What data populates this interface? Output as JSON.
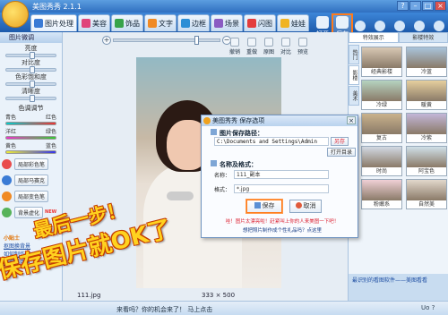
{
  "window": {
    "title": "美图秀秀 2.1.1",
    "logo_text": "Merry Christmas"
  },
  "tabs": [
    {
      "label": "图片处理",
      "icon": "picture-icon",
      "color": "#3a7bd5"
    },
    {
      "label": "美容",
      "icon": "heart-icon",
      "color": "#e0457b"
    },
    {
      "label": "饰品",
      "icon": "flower-icon",
      "color": "#37a34a"
    },
    {
      "label": "文字",
      "icon": "text-icon",
      "color": "#f08a24"
    },
    {
      "label": "边框",
      "icon": "frame-icon",
      "color": "#2c8fd6"
    },
    {
      "label": "场景",
      "icon": "scene-icon",
      "color": "#8b5cc2"
    },
    {
      "label": "闪图",
      "icon": "flash-icon",
      "color": "#e33c3c"
    },
    {
      "label": "娃娃",
      "icon": "doll-icon",
      "color": "#f0b424"
    }
  ],
  "toolbar": {
    "open_label": "打开",
    "save_label": "保存",
    "right_tools": [
      "抠图",
      "旋转",
      "裁剪",
      "尺寸",
      "涂鸦"
    ]
  },
  "left_panel": {
    "header": "图片微调",
    "sliders": [
      "亮度",
      "对比度",
      "色彩饱和度",
      "清晰度"
    ],
    "color_adjust_label": "色调调节",
    "color_pairs": [
      {
        "left": "青色",
        "right": "红色",
        "gradient": "linear-gradient(90deg,#0cc,#e33)"
      },
      {
        "left": "洋红",
        "right": "绿色",
        "gradient": "linear-gradient(90deg,#e3c,#3c3)"
      },
      {
        "left": "黄色",
        "right": "蓝色",
        "gradient": "linear-gradient(90deg,#ee3,#33e)"
      }
    ],
    "buttons": [
      {
        "label": "局部彩色笔",
        "color": "#e94c4c"
      },
      {
        "label": "局部马赛克",
        "color": "#3a7bd5"
      },
      {
        "label": "局部变色笔",
        "color": "#f08a24"
      },
      {
        "label": "背景虚化",
        "color": "#57b35a",
        "new": "NEW"
      }
    ],
    "tips_header": "小贴士",
    "links": [
      "抠图换背景",
      "如何制作闪",
      "局部彩色笔"
    ]
  },
  "canvas": {
    "tools": [
      "撤销",
      "重做",
      "原图",
      "对比",
      "预览"
    ],
    "file_name": "111.jpg",
    "image_size": "333 × 500"
  },
  "right_panel": {
    "tabs": [
      "特效展示",
      "影楼特效"
    ],
    "vertical_tabs": [
      "热门",
      "影楼",
      "美术"
    ],
    "effects": [
      "经典影楼",
      "冷蓝",
      "冷绿",
      "暖黄",
      "复古",
      "冷紫",
      "时尚",
      "阿宝色",
      "粉嫩系",
      "自然美"
    ],
    "bottom_text": "最识别的看图软件——美图看看"
  },
  "footer": {
    "message": "来看吗？你的机会来了！ 马上点击",
    "icons": [
      "Uo",
      "?"
    ]
  },
  "dialog": {
    "title": "美图秀秀 保存选项",
    "close": "×",
    "path_section": "图片保存路径：",
    "path_value": "C:\\Documents and Settings\\Admin",
    "save_as_button": "另存",
    "open_folder_button": "打开目录",
    "name_section": "名称及格式：",
    "name_label": "名称：",
    "name_value": "111_副本",
    "format_label": "格式：",
    "format_value": "*.jpg",
    "save_button": "保存",
    "cancel_button": "取消",
    "tip_text": "哇！图片太漂亮啦！赶紧叫上你的人来美图一下吧！",
    "link_text": "想把照片制作成个性礼品吗？点这里"
  },
  "overlay": {
    "line1": "最后一步！",
    "line2": "保存图片就OK了"
  }
}
